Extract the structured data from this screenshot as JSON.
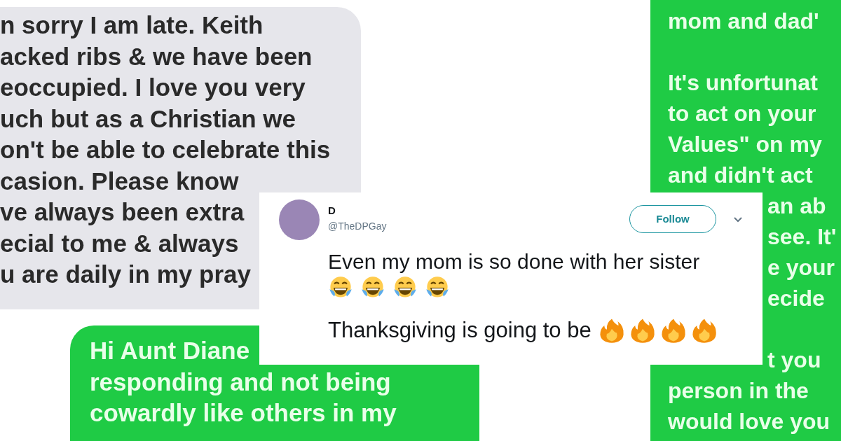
{
  "received_bubble": {
    "lines": [
      {
        "text": "n sorry I am late. Keith"
      },
      {
        "text": "acked ribs & we have been"
      },
      {
        "text": "eoccupied. I love you very"
      },
      {
        "text": "uch but as a Christian we"
      },
      {
        "text": "on't be able to celebrate this"
      },
      {
        "text": "casion. Please know"
      },
      {
        "text": "ve always been extra"
      },
      {
        "text": "ecial to me & always"
      },
      {
        "text": "u are daily in my pray"
      }
    ]
  },
  "sent_bubble_bottom": {
    "lines": [
      {
        "text": "Hi Aunt Diane"
      },
      {
        "text": "responding and not being"
      },
      {
        "text": "cowardly like others in my"
      }
    ]
  },
  "sent_bubble_right": {
    "lines": [
      {
        "text": "mom and dad'",
        "kind": "full"
      },
      {
        "text": "It's unfortunat",
        "kind": "gap"
      },
      {
        "text": "to act on your",
        "kind": "full"
      },
      {
        "text": "Values\" on my",
        "kind": "full"
      },
      {
        "text": "and didn't act",
        "kind": "full"
      },
      {
        "text": "an ab",
        "kind": "clipped"
      },
      {
        "text": "see. It'",
        "kind": "clipped"
      },
      {
        "text": "e your",
        "kind": "clipped"
      },
      {
        "text": "ecide",
        "kind": "clipped"
      },
      {
        "text": "t you",
        "kind": "gap_clipped"
      },
      {
        "text": "person in the",
        "kind": "full"
      },
      {
        "text": "would love you",
        "kind": "full"
      }
    ]
  },
  "tweet": {
    "name": "D",
    "handle": "@TheDPGay",
    "follow_button": "Follow",
    "paragraphs": [
      {
        "text": "Even my mom is so done with her sister",
        "emojis": [
          {
            "kind": "laughing"
          },
          {
            "kind": "laughing"
          },
          {
            "kind": "laughing"
          },
          {
            "kind": "laughing"
          }
        ],
        "kind": "emoji_below"
      },
      {
        "text": "Thanksgiving is going to be",
        "emojis": [
          {
            "kind": "fire"
          },
          {
            "kind": "fire"
          },
          {
            "kind": "fire"
          },
          {
            "kind": "fire"
          }
        ],
        "kind": "emoji_inline"
      }
    ]
  }
}
